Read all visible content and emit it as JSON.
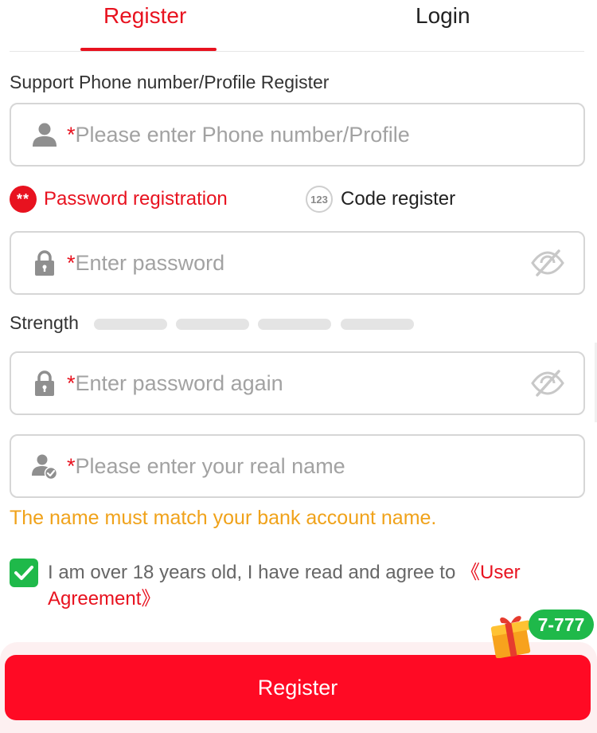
{
  "tabs": {
    "register": "Register",
    "login": "Login",
    "active": "register"
  },
  "support_label": "Support Phone number/Profile Register",
  "required_mark": "*",
  "fields": {
    "phone": {
      "placeholder": "Please enter Phone number/Profile",
      "icon": "user-icon"
    },
    "password": {
      "placeholder": "Enter password",
      "icon": "lock-icon",
      "toggle_icon": "eye-off-icon"
    },
    "password_again": {
      "placeholder": "Enter password again",
      "icon": "lock-icon",
      "toggle_icon": "eye-off-icon"
    },
    "real_name": {
      "placeholder": "Please enter your real name",
      "icon": "user-check-icon"
    }
  },
  "modes": {
    "password": {
      "badge": "**",
      "label": "Password registration",
      "selected": true
    },
    "code": {
      "badge": "123",
      "label": "Code register",
      "selected": false
    }
  },
  "strength": {
    "label": "Strength",
    "level": 0,
    "segments": 4
  },
  "name_warning": "The name must match your bank account name.",
  "agreement": {
    "checked": true,
    "text": "I am over 18 years old, I have read and agree to ",
    "link": "《User Agreement》"
  },
  "gift": {
    "icon": "gift-box-icon",
    "badge": "7-777"
  },
  "submit_label": "Register",
  "colors": {
    "accent": "#e8121f",
    "button": "#ff0a24",
    "warning": "#f0a21a",
    "check": "#1fb94a"
  }
}
